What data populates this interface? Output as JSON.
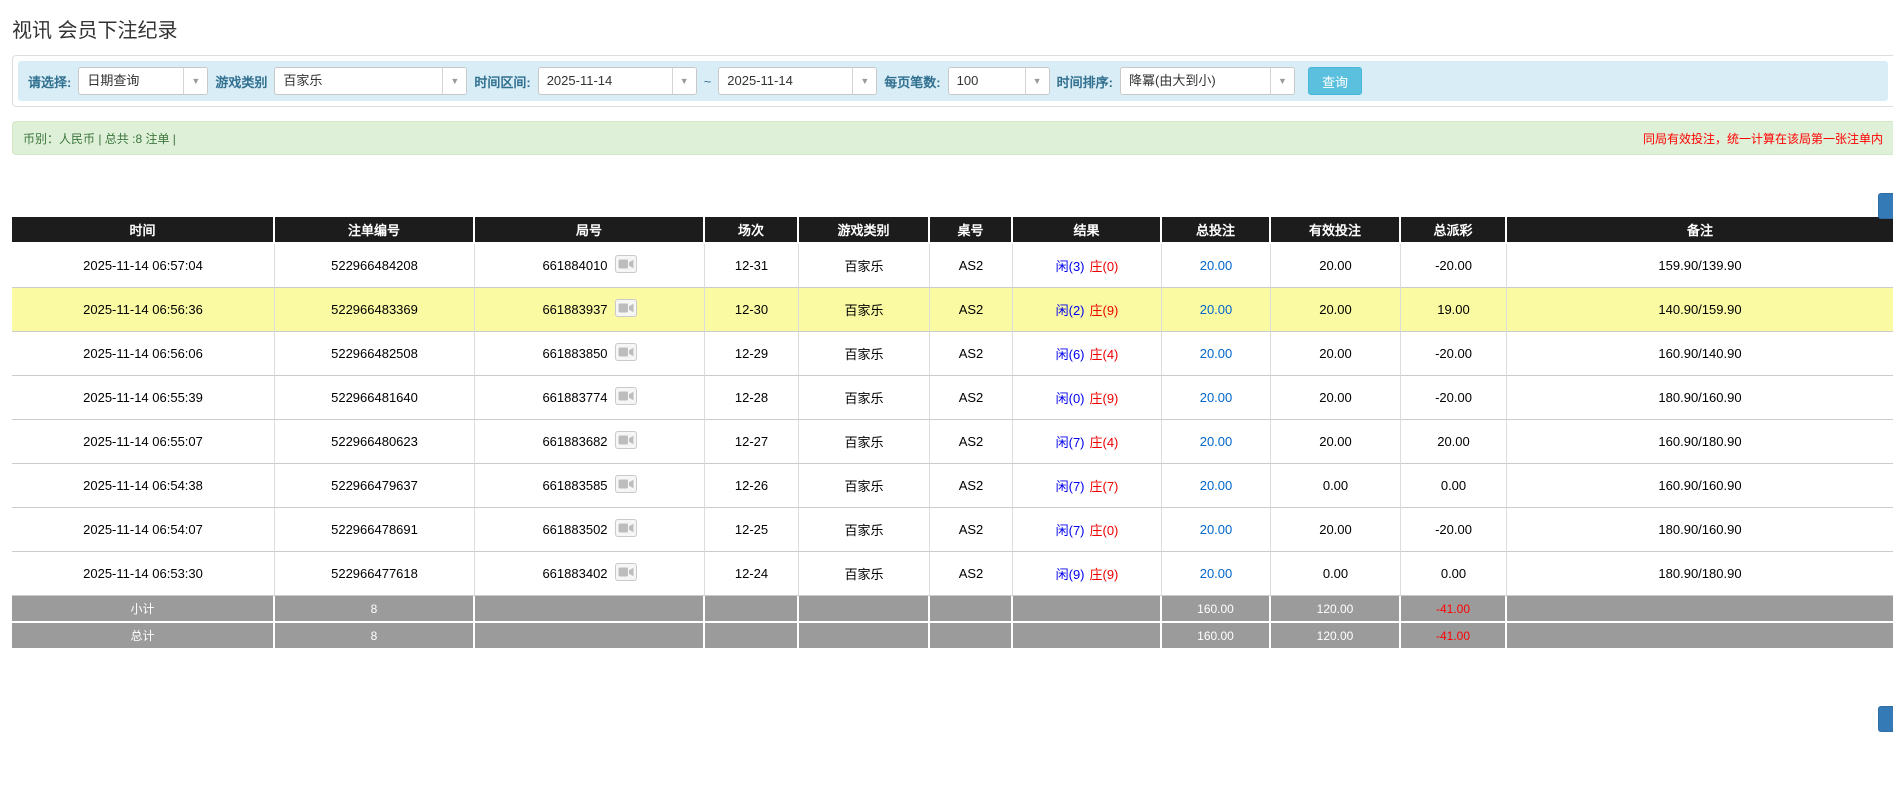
{
  "page": {
    "title": "视讯 会员下注纪录"
  },
  "filters": {
    "select_label": "请选择:",
    "select_value": "日期查询",
    "game_type_label": "游戏类别",
    "game_type_value": "百家乐",
    "time_range_label": "时间区间:",
    "date_from": "2025-11-14",
    "range_separator": "~",
    "date_to": "2025-11-14",
    "page_size_label": "每页笔数:",
    "page_size_value": "100",
    "sort_label": "时间排序:",
    "sort_value": "降冪(由大到小)",
    "search_button": "查询",
    "dropdown_arrow": "▼"
  },
  "info_bar": {
    "summary": "币别：人民币 | 总共 :8 注单 |",
    "notice": "同局有效投注，统一计算在该局第一张注单内"
  },
  "table": {
    "headers": [
      "时间",
      "注单编号",
      "局号",
      "场次",
      "游戏类别",
      "桌号",
      "结果",
      "总投注",
      "有效投注",
      "总派彩",
      "备注"
    ],
    "rows": [
      {
        "time": "2025-11-14 06:57:04",
        "bet_id": "522966484208",
        "round_id": "661884010",
        "session": "12-31",
        "game": "百家乐",
        "table_no": "AS2",
        "player": "闲(3)",
        "banker": "庄(0)",
        "total_bet": "20.00",
        "valid_bet": "20.00",
        "payout": "-20.00",
        "note": "159.90/139.90",
        "highlight": false
      },
      {
        "time": "2025-11-14 06:56:36",
        "bet_id": "522966483369",
        "round_id": "661883937",
        "session": "12-30",
        "game": "百家乐",
        "table_no": "AS2",
        "player": "闲(2)",
        "banker": "庄(9)",
        "total_bet": "20.00",
        "valid_bet": "20.00",
        "payout": "19.00",
        "note": "140.90/159.90",
        "highlight": true
      },
      {
        "time": "2025-11-14 06:56:06",
        "bet_id": "522966482508",
        "round_id": "661883850",
        "session": "12-29",
        "game": "百家乐",
        "table_no": "AS2",
        "player": "闲(6)",
        "banker": "庄(4)",
        "total_bet": "20.00",
        "valid_bet": "20.00",
        "payout": "-20.00",
        "note": "160.90/140.90",
        "highlight": false
      },
      {
        "time": "2025-11-14 06:55:39",
        "bet_id": "522966481640",
        "round_id": "661883774",
        "session": "12-28",
        "game": "百家乐",
        "table_no": "AS2",
        "player": "闲(0)",
        "banker": "庄(9)",
        "total_bet": "20.00",
        "valid_bet": "20.00",
        "payout": "-20.00",
        "note": "180.90/160.90",
        "highlight": false
      },
      {
        "time": "2025-11-14 06:55:07",
        "bet_id": "522966480623",
        "round_id": "661883682",
        "session": "12-27",
        "game": "百家乐",
        "table_no": "AS2",
        "player": "闲(7)",
        "banker": "庄(4)",
        "total_bet": "20.00",
        "valid_bet": "20.00",
        "payout": "20.00",
        "note": "160.90/180.90",
        "highlight": false
      },
      {
        "time": "2025-11-14 06:54:38",
        "bet_id": "522966479637",
        "round_id": "661883585",
        "session": "12-26",
        "game": "百家乐",
        "table_no": "AS2",
        "player": "闲(7)",
        "banker": "庄(7)",
        "total_bet": "20.00",
        "valid_bet": "0.00",
        "payout": "0.00",
        "note": "160.90/160.90",
        "highlight": false
      },
      {
        "time": "2025-11-14 06:54:07",
        "bet_id": "522966478691",
        "round_id": "661883502",
        "session": "12-25",
        "game": "百家乐",
        "table_no": "AS2",
        "player": "闲(7)",
        "banker": "庄(0)",
        "total_bet": "20.00",
        "valid_bet": "20.00",
        "payout": "-20.00",
        "note": "180.90/160.90",
        "highlight": false
      },
      {
        "time": "2025-11-14 06:53:30",
        "bet_id": "522966477618",
        "round_id": "661883402",
        "session": "12-24",
        "game": "百家乐",
        "table_no": "AS2",
        "player": "闲(9)",
        "banker": "庄(9)",
        "total_bet": "20.00",
        "valid_bet": "0.00",
        "payout": "0.00",
        "note": "180.90/180.90",
        "highlight": false
      }
    ],
    "subtotal": {
      "label": "小计",
      "count": "8",
      "total_bet": "160.00",
      "valid_bet": "120.00",
      "payout": "-41.00"
    },
    "total": {
      "label": "总计",
      "count": "8",
      "total_bet": "160.00",
      "valid_bet": "120.00",
      "payout": "-41.00"
    }
  },
  "colors": {
    "accent_blue": "#337ab7",
    "search_button": "#5bc0de",
    "header_black": "#1c1c1c",
    "highlight_yellow": "#fafaa3",
    "summary_gray": "#9b9b9b",
    "negative_red": "#ff0000",
    "link_blue": "#0066cc"
  }
}
